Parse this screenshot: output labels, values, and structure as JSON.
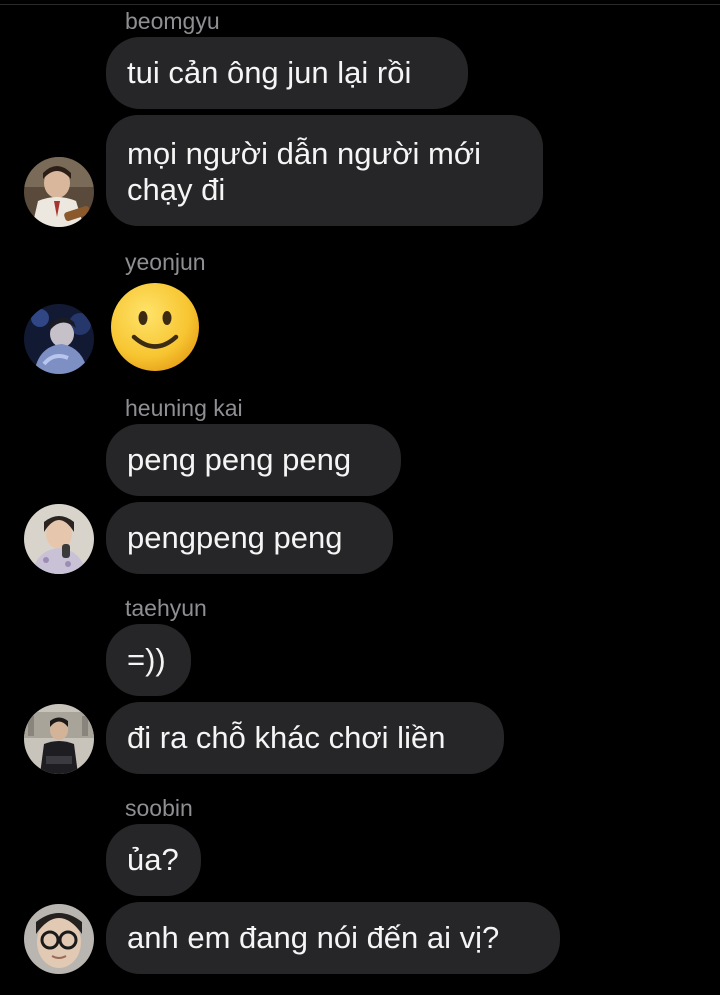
{
  "chat": {
    "messages": [
      {
        "sender": "beomgyu",
        "avatar_icon": "avatar-beomgyu",
        "bubbles": [
          "tui cản ông jun lại rồi",
          "mọi người dẫn người mới",
          "chạy đi"
        ]
      },
      {
        "sender": "yeonjun",
        "avatar_icon": "avatar-yeonjun",
        "bubbles": [
          "slightly-smiling-face-emoji"
        ]
      },
      {
        "sender": "heuning kai",
        "avatar_icon": "avatar-heuning-kai",
        "bubbles": [
          "peng peng peng",
          "pengpeng peng"
        ]
      },
      {
        "sender": "taehyun",
        "avatar_icon": "avatar-taehyun",
        "bubbles": [
          "=))",
          "đi ra chỗ khác chơi liền"
        ]
      },
      {
        "sender": "soobin",
        "avatar_icon": "avatar-soobin",
        "bubbles": [
          "ủa?",
          "anh em đang nói đến ai vị?"
        ]
      }
    ]
  },
  "colors": {
    "background": "#000000",
    "bubble": "#262628",
    "sender_name": "#8e8e93",
    "message_text": "#f5f5f5"
  }
}
